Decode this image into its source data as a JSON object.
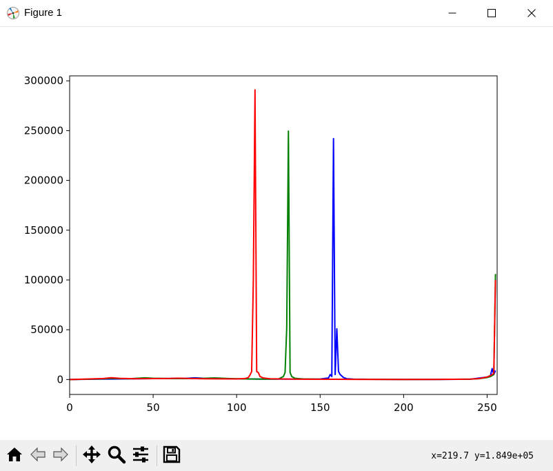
{
  "window": {
    "title": "Figure 1",
    "icons": {
      "app": "matplotlib-logo-icon",
      "minimize": "minimize-icon",
      "maximize": "maximize-icon",
      "close": "close-icon"
    }
  },
  "toolbar": {
    "buttons": [
      {
        "name": "home-button",
        "icon": "home-icon"
      },
      {
        "name": "back-button",
        "icon": "arrow-left-icon"
      },
      {
        "name": "forward-button",
        "icon": "arrow-right-icon"
      },
      {
        "name": "pan-button",
        "icon": "move-icon"
      },
      {
        "name": "zoom-button",
        "icon": "magnifier-icon"
      },
      {
        "name": "configure-subplots-button",
        "icon": "sliders-icon"
      },
      {
        "name": "save-button",
        "icon": "floppy-disk-icon"
      }
    ],
    "coordinates": "x=219.7 y=1.849e+05"
  },
  "chart_data": {
    "type": "line",
    "title": "",
    "xlabel": "",
    "ylabel": "",
    "xlim": [
      0,
      256
    ],
    "ylim": [
      -15000,
      305000
    ],
    "xticks": [
      0,
      50,
      100,
      150,
      200,
      250
    ],
    "yticks": [
      0,
      50000,
      100000,
      150000,
      200000,
      250000,
      300000
    ],
    "grid": false,
    "legend": "none",
    "series": [
      {
        "color": "#0000ff",
        "points": [
          [
            0,
            0
          ],
          [
            10,
            200
          ],
          [
            20,
            400
          ],
          [
            30,
            600
          ],
          [
            40,
            800
          ],
          [
            50,
            900
          ],
          [
            60,
            1000
          ],
          [
            70,
            1200
          ],
          [
            75,
            1700
          ],
          [
            80,
            1300
          ],
          [
            90,
            900
          ],
          [
            100,
            700
          ],
          [
            110,
            500
          ],
          [
            120,
            400
          ],
          [
            130,
            400
          ],
          [
            140,
            400
          ],
          [
            150,
            500
          ],
          [
            155,
            1500
          ],
          [
            156,
            5000
          ],
          [
            157,
            3000
          ],
          [
            158,
            242000
          ],
          [
            159,
            5000
          ],
          [
            160,
            51000
          ],
          [
            161,
            8000
          ],
          [
            162,
            5000
          ],
          [
            164,
            2000
          ],
          [
            166,
            800
          ],
          [
            170,
            400
          ],
          [
            180,
            200
          ],
          [
            200,
            100
          ],
          [
            220,
            100
          ],
          [
            240,
            300
          ],
          [
            250,
            2500
          ],
          [
            252,
            4000
          ],
          [
            253,
            11000
          ],
          [
            254,
            5000
          ],
          [
            255,
            9000
          ]
        ]
      },
      {
        "color": "#008000",
        "points": [
          [
            0,
            0
          ],
          [
            10,
            300
          ],
          [
            20,
            700
          ],
          [
            25,
            1200
          ],
          [
            30,
            900
          ],
          [
            35,
            800
          ],
          [
            40,
            1200
          ],
          [
            45,
            1700
          ],
          [
            50,
            1300
          ],
          [
            60,
            900
          ],
          [
            70,
            900
          ],
          [
            80,
            1200
          ],
          [
            87,
            1600
          ],
          [
            95,
            1000
          ],
          [
            100,
            800
          ],
          [
            105,
            600
          ],
          [
            110,
            500
          ],
          [
            120,
            400
          ],
          [
            125,
            500
          ],
          [
            128,
            3000
          ],
          [
            129,
            7000
          ],
          [
            130,
            52000
          ],
          [
            131,
            249500
          ],
          [
            132,
            7000
          ],
          [
            133,
            3000
          ],
          [
            135,
            1200
          ],
          [
            140,
            600
          ],
          [
            150,
            300
          ],
          [
            170,
            200
          ],
          [
            200,
            100
          ],
          [
            230,
            200
          ],
          [
            240,
            400
          ],
          [
            245,
            800
          ],
          [
            250,
            2000
          ],
          [
            252,
            3000
          ],
          [
            254,
            5000
          ],
          [
            255,
            106000
          ]
        ]
      },
      {
        "color": "#ff0000",
        "points": [
          [
            0,
            0
          ],
          [
            10,
            500
          ],
          [
            20,
            1000
          ],
          [
            25,
            1800
          ],
          [
            30,
            1200
          ],
          [
            40,
            800
          ],
          [
            50,
            900
          ],
          [
            60,
            1100
          ],
          [
            65,
            1400
          ],
          [
            70,
            1100
          ],
          [
            80,
            800
          ],
          [
            90,
            700
          ],
          [
            100,
            600
          ],
          [
            105,
            1000
          ],
          [
            107,
            2000
          ],
          [
            108,
            4500
          ],
          [
            109,
            8000
          ],
          [
            110,
            100000
          ],
          [
            111,
            291000
          ],
          [
            112,
            8000
          ],
          [
            113,
            7000
          ],
          [
            114,
            3000
          ],
          [
            116,
            1500
          ],
          [
            120,
            800
          ],
          [
            130,
            500
          ],
          [
            140,
            300
          ],
          [
            160,
            200
          ],
          [
            200,
            100
          ],
          [
            230,
            200
          ],
          [
            240,
            400
          ],
          [
            245,
            900
          ],
          [
            250,
            2500
          ],
          [
            252,
            4000
          ],
          [
            254,
            6000
          ],
          [
            255,
            100000
          ]
        ]
      }
    ]
  }
}
